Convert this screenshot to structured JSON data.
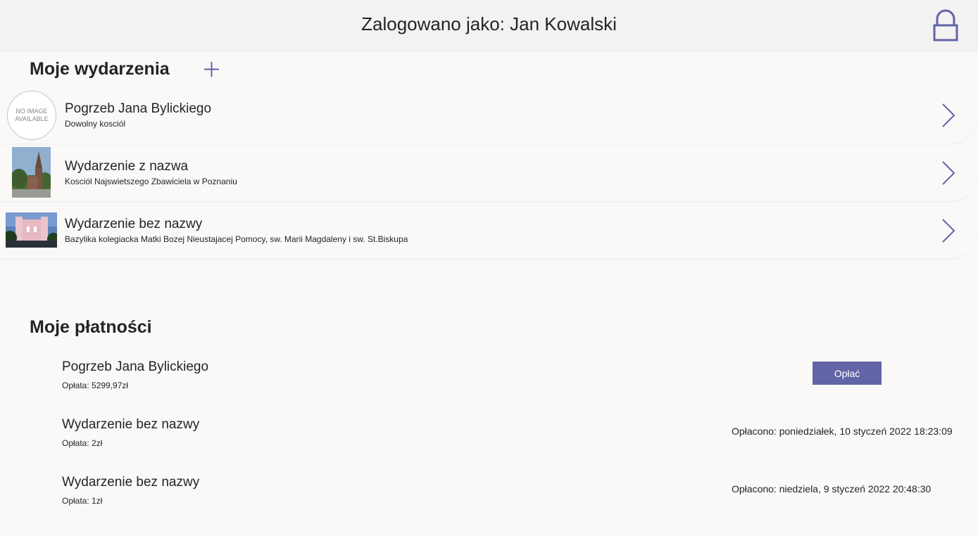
{
  "header": {
    "title": "Zalogowano jako: Jan Kowalski",
    "lock_icon": "lock-icon"
  },
  "events_section": {
    "title": "Moje wydarzenia",
    "add_icon": "plus-icon",
    "items": [
      {
        "name": "Pogrzeb Jana Bylickiego",
        "place": "Dowolny kosciól",
        "thumbnail_text": [
          "NO IMAGE",
          "AVAILABLE"
        ]
      },
      {
        "name": "Wydarzenie z nazwa",
        "place": "Kosciól Najswietszego Zbawiciela w Poznaniu"
      },
      {
        "name": "Wydarzenie bez nazwy",
        "place": "Bazylika kolegiacka Matki Bozej Nieustajacej Pomocy, sw. Marii Magdaleny i sw. St.Biskupa"
      }
    ]
  },
  "payments_section": {
    "title": "Moje płatności",
    "items": [
      {
        "name": "Pogrzeb Jana Bylickiego",
        "amount": "Opłata: 5299,97zł",
        "action_label": "Opłać"
      },
      {
        "name": "Wydarzenie bez nazwy",
        "amount": "Opłata: 2zł",
        "status": "Opłacono: poniedziałek, 10 styczeń 2022 18:23:09"
      },
      {
        "name": "Wydarzenie bez nazwy",
        "amount": "Opłata: 1zł",
        "status": "Opłacono: niedziela, 9 styczeń 2022 20:48:30"
      }
    ]
  },
  "colors": {
    "accent": "#6264a7",
    "header_bg": "#f3f2f1",
    "page_bg": "#faf9f8",
    "text": "#252423"
  }
}
